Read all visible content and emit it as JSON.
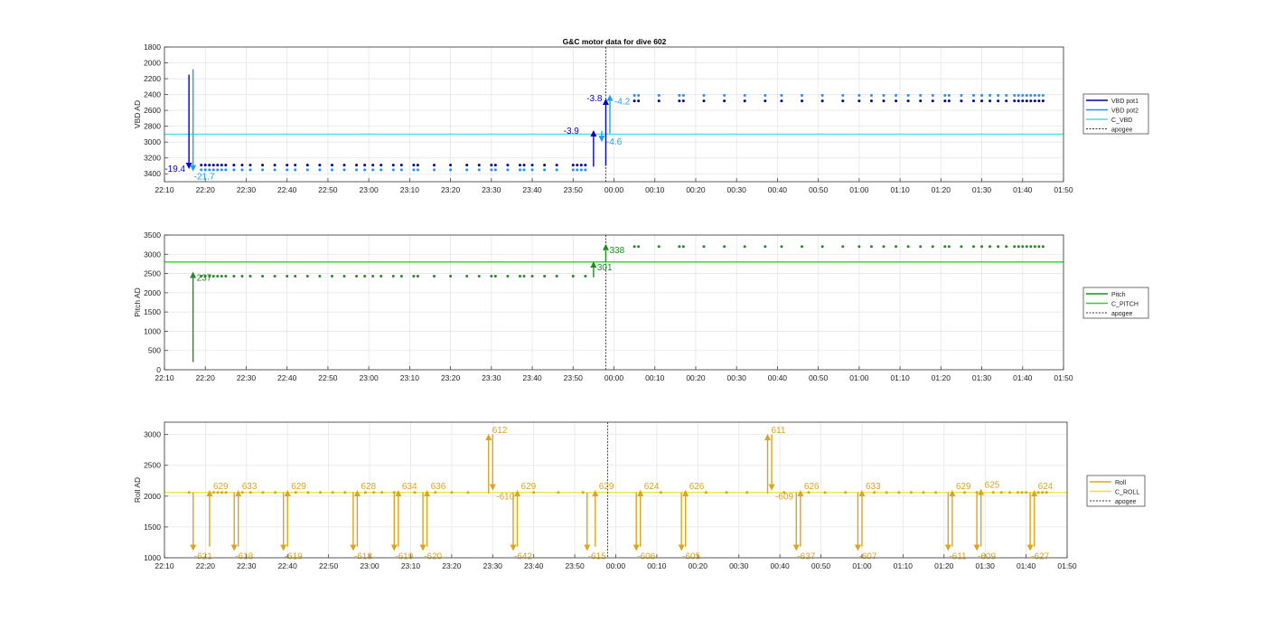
{
  "figure": {
    "title": "G&C motor data for dive 602"
  },
  "colors": {
    "vbd_pot1": "#00008b",
    "vbd_pot2": "#1e90ff",
    "c_vbd": "#40e0e8",
    "pitch": "#228b22",
    "c_pitch": "#32cd32",
    "roll": "#daa520",
    "c_roll": "#f0e030",
    "apogee": "#333333",
    "grid": "#e6e6e6"
  },
  "chart_data": [
    {
      "type": "scatter",
      "panel": "vbd",
      "title": "G&C motor data for dive 602",
      "xlabel": "",
      "ylabel": "VBD AD",
      "xlim": [
        "22:10",
        "01:50"
      ],
      "ylim": [
        1800,
        3500
      ],
      "y_reversed": true,
      "xticks": [
        "22:10",
        "22:20",
        "22:30",
        "22:40",
        "22:50",
        "23:00",
        "23:10",
        "23:20",
        "23:30",
        "23:40",
        "23:50",
        "00:00",
        "00:10",
        "00:20",
        "00:30",
        "00:40",
        "00:50",
        "01:00",
        "01:10",
        "01:20",
        "01:30",
        "01:40",
        "01:50"
      ],
      "yticks": [
        1800,
        2000,
        2200,
        2400,
        2600,
        2800,
        3000,
        3200,
        3400
      ],
      "grid": true,
      "legend": {
        "placement": "outside-right",
        "entries": [
          "VBD pot1",
          "VBD pot2",
          "C_VBD",
          "apogee"
        ]
      },
      "hlines": [
        {
          "name": "C_VBD",
          "y": 2900
        }
      ],
      "apogee_time": "23:58",
      "series": [
        {
          "name": "VBD pot1",
          "y": 3290,
          "times": [
            "22:19",
            "22:20",
            "22:21",
            "22:22",
            "22:23",
            "22:24",
            "22:25",
            "22:27",
            "22:29",
            "22:31",
            "22:34",
            "22:37",
            "22:40",
            "22:42",
            "22:45",
            "22:48",
            "22:51",
            "22:54",
            "22:57",
            "22:59",
            "23:01",
            "23:03",
            "23:06",
            "23:08",
            "23:11",
            "23:12",
            "23:16",
            "23:20",
            "23:24",
            "23:27",
            "23:30",
            "23:31",
            "23:34",
            "23:37",
            "23:38",
            "23:40",
            "23:43",
            "23:46",
            "23:50",
            "23:51",
            "23:52",
            "23:53"
          ]
        },
        {
          "name": "VBD pot1",
          "y": 2480,
          "times": [
            "00:05",
            "00:06",
            "00:11",
            "00:16",
            "00:17",
            "00:22",
            "00:27",
            "00:32",
            "00:37",
            "00:41",
            "00:46",
            "00:51",
            "00:56",
            "01:00",
            "01:03",
            "01:06",
            "01:09",
            "01:12",
            "01:15",
            "01:18",
            "01:21",
            "01:22",
            "01:25",
            "01:28",
            "01:30",
            "01:32",
            "01:34",
            "01:36",
            "01:38",
            "01:39",
            "01:40",
            "01:41",
            "01:42",
            "01:43",
            "01:44",
            "01:45"
          ]
        },
        {
          "name": "VBD pot2",
          "y": 3350,
          "times": [
            "22:19",
            "22:20",
            "22:21",
            "22:22",
            "22:23",
            "22:24",
            "22:25",
            "22:27",
            "22:29",
            "22:31",
            "22:34",
            "22:37",
            "22:40",
            "22:42",
            "22:45",
            "22:48",
            "22:51",
            "22:54",
            "22:57",
            "22:59",
            "23:01",
            "23:03",
            "23:06",
            "23:08",
            "23:11",
            "23:12",
            "23:16",
            "23:20",
            "23:24",
            "23:27",
            "23:30",
            "23:31",
            "23:34",
            "23:37",
            "23:38",
            "23:40",
            "23:43",
            "23:46",
            "23:50",
            "23:51",
            "23:52",
            "23:53"
          ]
        },
        {
          "name": "VBD pot2",
          "y": 2410,
          "times": [
            "00:05",
            "00:06",
            "00:11",
            "00:16",
            "00:17",
            "00:22",
            "00:27",
            "00:32",
            "00:37",
            "00:41",
            "00:46",
            "00:51",
            "00:56",
            "01:00",
            "01:03",
            "01:06",
            "01:09",
            "01:12",
            "01:15",
            "01:18",
            "01:21",
            "01:22",
            "01:25",
            "01:28",
            "01:30",
            "01:32",
            "01:34",
            "01:36",
            "01:38",
            "01:39",
            "01:40",
            "01:41",
            "01:42",
            "01:43",
            "01:44",
            "01:45"
          ]
        }
      ],
      "arrows": [
        {
          "series": "VBD pot1",
          "time": "22:16",
          "from": 2150,
          "to": 3340,
          "label": "-19.4",
          "label_side": "left"
        },
        {
          "series": "VBD pot2",
          "time": "22:17",
          "from": 2080,
          "to": 3370,
          "label": "-21.7",
          "label_side": "below"
        },
        {
          "series": "VBD pot1",
          "time": "23:55",
          "from": 3310,
          "to": 2850,
          "label": "-3.9",
          "label_side": "left"
        },
        {
          "series": "VBD pot1",
          "time": "23:58",
          "from": 3300,
          "to": 2450,
          "label": "-3.8",
          "label_side": "left"
        },
        {
          "series": "VBD pot2",
          "time": "23:59",
          "from": 2890,
          "to": 2400,
          "label": "-4.2",
          "label_side": "right"
        },
        {
          "series": "C_VBD",
          "time": "23:57",
          "from": 2860,
          "to": 3000,
          "label": "-4.6",
          "label_side": "right"
        }
      ]
    },
    {
      "type": "scatter",
      "panel": "pitch",
      "xlabel": "",
      "ylabel": "Pitch AD",
      "xlim": [
        "22:10",
        "01:50"
      ],
      "ylim": [
        0,
        3500
      ],
      "xticks": [
        "22:10",
        "22:20",
        "22:30",
        "22:40",
        "22:50",
        "23:00",
        "23:10",
        "23:20",
        "23:30",
        "23:40",
        "23:50",
        "00:00",
        "00:10",
        "00:20",
        "00:30",
        "00:40",
        "00:50",
        "01:00",
        "01:10",
        "01:20",
        "01:30",
        "01:40",
        "01:50"
      ],
      "yticks": [
        0,
        500,
        1000,
        1500,
        2000,
        2500,
        3000,
        3500
      ],
      "grid": true,
      "legend": {
        "placement": "outside-right",
        "entries": [
          "Pitch",
          "C_PITCH",
          "apogee"
        ]
      },
      "hlines": [
        {
          "name": "C_PITCH",
          "y": 2800
        }
      ],
      "apogee_time": "23:58",
      "series": [
        {
          "name": "Pitch",
          "y": 2430,
          "times": [
            "22:19",
            "22:20",
            "22:21",
            "22:22",
            "22:23",
            "22:24",
            "22:25",
            "22:27",
            "22:29",
            "22:31",
            "22:34",
            "22:37",
            "22:40",
            "22:42",
            "22:45",
            "22:48",
            "22:51",
            "22:54",
            "22:57",
            "22:59",
            "23:01",
            "23:03",
            "23:06",
            "23:08",
            "23:11",
            "23:12",
            "23:16",
            "23:20",
            "23:24",
            "23:27",
            "23:30",
            "23:31",
            "23:34",
            "23:37",
            "23:38",
            "23:40",
            "23:43",
            "23:46",
            "23:50",
            "23:53"
          ]
        },
        {
          "name": "Pitch",
          "y": 3200,
          "times": [
            "00:05",
            "00:06",
            "00:11",
            "00:16",
            "00:17",
            "00:22",
            "00:27",
            "00:32",
            "00:37",
            "00:41",
            "00:46",
            "00:51",
            "00:56",
            "01:00",
            "01:03",
            "01:06",
            "01:09",
            "01:12",
            "01:15",
            "01:18",
            "01:21",
            "01:22",
            "01:25",
            "01:28",
            "01:30",
            "01:32",
            "01:34",
            "01:36",
            "01:38",
            "01:39",
            "01:40",
            "01:41",
            "01:42",
            "01:43",
            "01:44",
            "01:45"
          ]
        }
      ],
      "arrows": [
        {
          "series": "Pitch",
          "time": "22:17",
          "from": 200,
          "to": 2550,
          "label": "237",
          "label_side": "right-low"
        },
        {
          "series": "Pitch",
          "time": "23:55",
          "from": 2400,
          "to": 2820,
          "label": "301",
          "label_side": "right-low"
        },
        {
          "series": "Pitch",
          "time": "23:58",
          "from": 2820,
          "to": 3270,
          "label": "338",
          "label_side": "right-low"
        }
      ]
    },
    {
      "type": "scatter",
      "panel": "roll",
      "xlabel": "",
      "ylabel": "Roll AD",
      "xlim": [
        "22:10",
        "01:50"
      ],
      "ylim": [
        1000,
        3200
      ],
      "xticks": [
        "22:10",
        "22:20",
        "22:30",
        "22:40",
        "22:50",
        "23:00",
        "23:10",
        "23:20",
        "23:30",
        "23:40",
        "23:50",
        "00:00",
        "00:10",
        "00:20",
        "00:30",
        "00:40",
        "00:50",
        "01:00",
        "01:10",
        "01:20",
        "01:30",
        "01:40",
        "01:50"
      ],
      "yticks": [
        1000,
        1500,
        2000,
        2500,
        3000
      ],
      "grid": true,
      "legend": {
        "placement": "outside-right",
        "entries": [
          "Roll",
          "C_ROLL",
          "apogee"
        ]
      },
      "hlines": [
        {
          "name": "C_ROLL",
          "y": 2060
        }
      ],
      "apogee_time": "23:58",
      "series": [
        {
          "name": "Roll",
          "y": 2060,
          "times": [
            "22:16",
            "22:22",
            "22:23",
            "22:24",
            "22:25",
            "22:29",
            "22:31",
            "22:34",
            "22:37",
            "22:42",
            "22:45",
            "22:48",
            "22:51",
            "22:54",
            "22:59",
            "23:01",
            "23:03",
            "23:06",
            "23:11",
            "23:16",
            "23:20",
            "23:24",
            "23:40",
            "23:46",
            "23:52",
            "00:06",
            "00:11",
            "00:17",
            "00:22",
            "00:27",
            "00:32",
            "00:41",
            "00:47",
            "00:51",
            "00:56",
            "01:03",
            "01:06",
            "01:09",
            "01:12",
            "01:15",
            "01:18",
            "01:25",
            "01:28",
            "01:32",
            "01:34",
            "01:36",
            "01:38",
            "01:39",
            "01:40",
            "01:43",
            "01:44",
            "01:45"
          ]
        }
      ],
      "arrows": [
        {
          "time": "22:17",
          "from": 2060,
          "to": 1110,
          "label": "-621",
          "label_side": "below"
        },
        {
          "time": "22:21",
          "from": 1180,
          "to": 2100,
          "label": "629",
          "label_side": "right-high"
        },
        {
          "time": "22:27",
          "from": 2060,
          "to": 1110,
          "label": "-618",
          "label_side": "below"
        },
        {
          "time": "22:28",
          "from": 1180,
          "to": 2100,
          "label": "633",
          "label_side": "right-high"
        },
        {
          "time": "22:39",
          "from": 2060,
          "to": 1110,
          "label": "-619",
          "label_side": "below"
        },
        {
          "time": "22:40",
          "from": 1180,
          "to": 2100,
          "label": "629",
          "label_side": "right-high"
        },
        {
          "time": "22:56",
          "from": 2060,
          "to": 1110,
          "label": "-618",
          "label_side": "below"
        },
        {
          "time": "22:57",
          "from": 1180,
          "to": 2100,
          "label": "628",
          "label_side": "right-high"
        },
        {
          "time": "23:06",
          "from": 2060,
          "to": 1110,
          "label": "-619",
          "label_side": "below"
        },
        {
          "time": "23:07",
          "from": 1180,
          "to": 2100,
          "label": "634",
          "label_side": "right-high"
        },
        {
          "time": "23:13",
          "from": 2060,
          "to": 1110,
          "label": "-620",
          "label_side": "below"
        },
        {
          "time": "23:14",
          "from": 1180,
          "to": 2100,
          "label": "636",
          "label_side": "right-high"
        },
        {
          "time": "23:29",
          "from": 2040,
          "to": 3010,
          "label": "612",
          "label_side": "right-high"
        },
        {
          "time": "23:30",
          "from": 3000,
          "to": 2090,
          "label": "-610",
          "label_side": "right-low"
        },
        {
          "time": "23:35",
          "from": 2060,
          "to": 1110,
          "label": "-642",
          "label_side": "below"
        },
        {
          "time": "23:36",
          "from": 1180,
          "to": 2100,
          "label": "629",
          "label_side": "right-high"
        },
        {
          "time": "23:53",
          "from": 2060,
          "to": 1110,
          "label": "-615",
          "label_side": "below"
        },
        {
          "time": "23:55",
          "from": 1180,
          "to": 2100,
          "label": "629",
          "label_side": "right-high"
        },
        {
          "time": "00:05",
          "from": 2060,
          "to": 1110,
          "label": "-606",
          "label_side": "below"
        },
        {
          "time": "00:06",
          "from": 1180,
          "to": 2100,
          "label": "624",
          "label_side": "right-high"
        },
        {
          "time": "00:16",
          "from": 2060,
          "to": 1110,
          "label": "-605",
          "label_side": "below"
        },
        {
          "time": "00:17",
          "from": 1180,
          "to": 2100,
          "label": "626",
          "label_side": "right-high"
        },
        {
          "time": "00:37",
          "from": 2040,
          "to": 3010,
          "label": "611",
          "label_side": "right-high"
        },
        {
          "time": "00:38",
          "from": 3000,
          "to": 2090,
          "label": "-609",
          "label_side": "right-low"
        },
        {
          "time": "00:44",
          "from": 2060,
          "to": 1110,
          "label": "-637",
          "label_side": "below"
        },
        {
          "time": "00:45",
          "from": 1180,
          "to": 2100,
          "label": "626",
          "label_side": "right-high"
        },
        {
          "time": "00:59",
          "from": 2060,
          "to": 1110,
          "label": "-607",
          "label_side": "below"
        },
        {
          "time": "01:00",
          "from": 1180,
          "to": 2100,
          "label": "633",
          "label_side": "right-high"
        },
        {
          "time": "01:21",
          "from": 2060,
          "to": 1110,
          "label": "-611",
          "label_side": "below"
        },
        {
          "time": "01:22",
          "from": 1180,
          "to": 2100,
          "label": "629",
          "label_side": "right-high"
        },
        {
          "time": "01:28",
          "from": 2060,
          "to": 1110,
          "label": "-609",
          "label_side": "below"
        },
        {
          "time": "01:29",
          "from": 1180,
          "to": 2120,
          "label": "625",
          "label_side": "right-high"
        },
        {
          "time": "01:41",
          "from": 2060,
          "to": 1110,
          "label": "-627",
          "label_side": "below"
        },
        {
          "time": "01:42",
          "from": 1180,
          "to": 2100,
          "label": "624",
          "label_side": "right-high"
        }
      ]
    }
  ]
}
